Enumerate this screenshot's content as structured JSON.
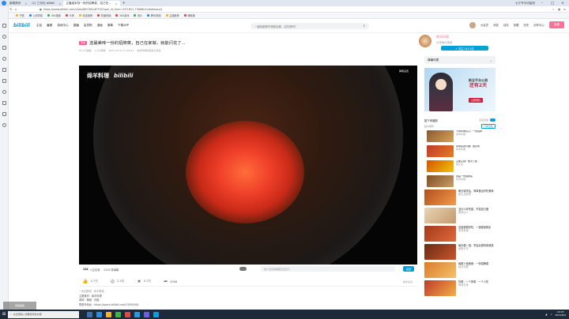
{
  "browser": {
    "tabs": [
      {
        "label": "新闻资讯"
      },
      {
        "label": "(1) 三次元-bilibili"
      },
      {
        "label": "主播迪米特一份的招牌菜，自己在..."
      }
    ],
    "new_tab": "+",
    "window_title_right": "七夕节马可装扮",
    "url": "https://www.bilibili.com/video/BV1KEy4F7Vt?spm_id_from=333.851.73866h4vfbd0eaca4",
    "bookmarks": [
      "书签",
      "上网导航",
      "360搜索",
      "头条",
      "精选推荐",
      "热播视频",
      "360游戏",
      "看片",
      "腾讯视频",
      "主播推荐",
      "爆款娱"
    ]
  },
  "bili": {
    "logo": "bilibili",
    "nav": [
      "主站",
      "番剧",
      "游戏中心",
      "直播",
      "会员购",
      "漫画",
      "赛事",
      "下载APP"
    ],
    "search_placeholder": "一键炖菜教学视频合集，这吃够吗？",
    "header_right": [
      "大会员",
      "消息",
      "动态",
      "收藏",
      "历史",
      "创作中心"
    ],
    "upload_label": "投稿"
  },
  "video": {
    "badge": "原创",
    "title": "送最美味一份的招牌菜，自己在家做，就能闪花了...",
    "meta": [
      "10.1万播放",
      "1.3万弹幕",
      "2021-04-11 11:28:42",
      "未经作者授权禁止转载"
    ],
    "watermark": "绵羊料理",
    "watermark_logo": "bilibili",
    "player_btn": "弹幕设置"
  },
  "danmubar": {
    "count": "124",
    "count_suffix": "人正在看",
    "danmu_count": "2245 条弹幕",
    "placeholder": "发个友善的弹幕见证当下",
    "send": "发送"
  },
  "actions": {
    "like": "3.7万",
    "coin": "2.4万",
    "fav": "4.7万",
    "share": "4568",
    "report": "稿件投诉"
  },
  "desc": {
    "line1": "一份招牌菜 · 新手教程",
    "line2": "主要食材：绵羊料理",
    "line3": "调味：辣椒 · 花椒",
    "line4": "购物车地址：https://space.bilibili.com/23950564"
  },
  "uploader": {
    "name": "绵羊料理",
    "bio": "分享每日美食",
    "follow": "+ 关注 143.5万"
  },
  "right": {
    "danmulist": "弹幕列表",
    "ad_text": "新全平台公测",
    "ad_text2": "还有2天",
    "ad_btn": "立即预约",
    "rec_header": "接下来播放",
    "auto_play": "自动连播",
    "rec_sub": "相关推荐",
    "rec_btn": "订阅合集",
    "recs": [
      {
        "title": "干锅牛肉丸子！一份招牌",
        "sub": "绵羊料理"
      },
      {
        "title": "家常菜这么做！更好吃",
        "sub": "绵羊料理"
      },
      {
        "title": "又酸又辣！绝对下饭",
        "sub": "新生活"
      },
      {
        "title": "这是一份招牌菜",
        "sub": "绵羊料理"
      }
    ],
    "recs2": [
      {
        "title": "两分钟学会，简单做出好吃美味",
        "sub": "新生活厨房"
      },
      {
        "title": "当什么好吃菜，不如自己做",
        "sub": "美食达人"
      },
      {
        "title": "这道菜很好吃，一道菜就搞定",
        "sub": "家常菜谱"
      },
      {
        "title": "每天做一道，学会后很有成就感",
        "sub": "美食分享"
      },
      {
        "title": "每周十道美食：一份招牌菜",
        "sub": "绵羊料理"
      },
      {
        "title": "好看：一个简单 · 一个人吃",
        "sub": "美味日常"
      }
    ]
  },
  "floatbox": "视频播放",
  "taskbar": {
    "search": "在这里输入你要搜索的内容",
    "time": "16:33",
    "date": "2021/8/3"
  }
}
